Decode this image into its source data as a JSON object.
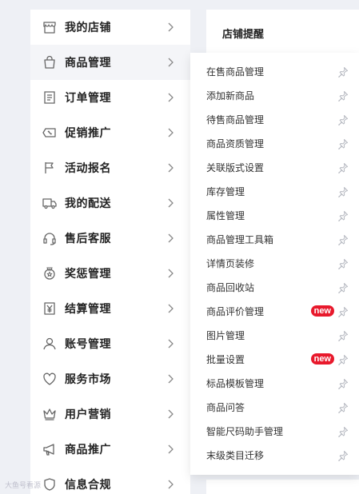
{
  "sidebar": {
    "items": [
      {
        "label": "我的店铺",
        "icon": "store-icon"
      },
      {
        "label": "商品管理",
        "icon": "shopping-bag-icon"
      },
      {
        "label": "订单管理",
        "icon": "document-icon"
      },
      {
        "label": "促销推广",
        "icon": "coupon-icon"
      },
      {
        "label": "活动报名",
        "icon": "flag-icon"
      },
      {
        "label": "我的配送",
        "icon": "truck-icon"
      },
      {
        "label": "售后客服",
        "icon": "headset-icon"
      },
      {
        "label": "奖惩管理",
        "icon": "medal-icon"
      },
      {
        "label": "结算管理",
        "icon": "yuan-icon"
      },
      {
        "label": "账号管理",
        "icon": "user-icon"
      },
      {
        "label": "服务市场",
        "icon": "heart-icon"
      },
      {
        "label": "用户营销",
        "icon": "crown-icon"
      },
      {
        "label": "商品推广",
        "icon": "megaphone-icon"
      },
      {
        "label": "信息合规",
        "icon": "shield-icon"
      }
    ]
  },
  "notice": {
    "title": "店铺提醒"
  },
  "submenu": {
    "items": [
      {
        "label": "在售商品管理",
        "badge": ""
      },
      {
        "label": "添加新商品",
        "badge": ""
      },
      {
        "label": "待售商品管理",
        "badge": ""
      },
      {
        "label": "商品资质管理",
        "badge": ""
      },
      {
        "label": "关联版式设置",
        "badge": ""
      },
      {
        "label": "库存管理",
        "badge": ""
      },
      {
        "label": "属性管理",
        "badge": ""
      },
      {
        "label": "商品管理工具箱",
        "badge": ""
      },
      {
        "label": "详情页装修",
        "badge": ""
      },
      {
        "label": "商品回收站",
        "badge": ""
      },
      {
        "label": "商品评价管理",
        "badge": "new"
      },
      {
        "label": "图片管理",
        "badge": ""
      },
      {
        "label": "批量设置",
        "badge": "new"
      },
      {
        "label": "标品模板管理",
        "badge": ""
      },
      {
        "label": "商品问答",
        "badge": ""
      },
      {
        "label": "智能尺码助手管理",
        "badge": ""
      },
      {
        "label": "末级类目迁移",
        "badge": ""
      }
    ]
  },
  "watermark": {
    "text": "大鱼号看源"
  },
  "colors": {
    "badge": "#e8192c",
    "active_bg": "#f4f5f8",
    "page_bg": "#eef0f5"
  }
}
